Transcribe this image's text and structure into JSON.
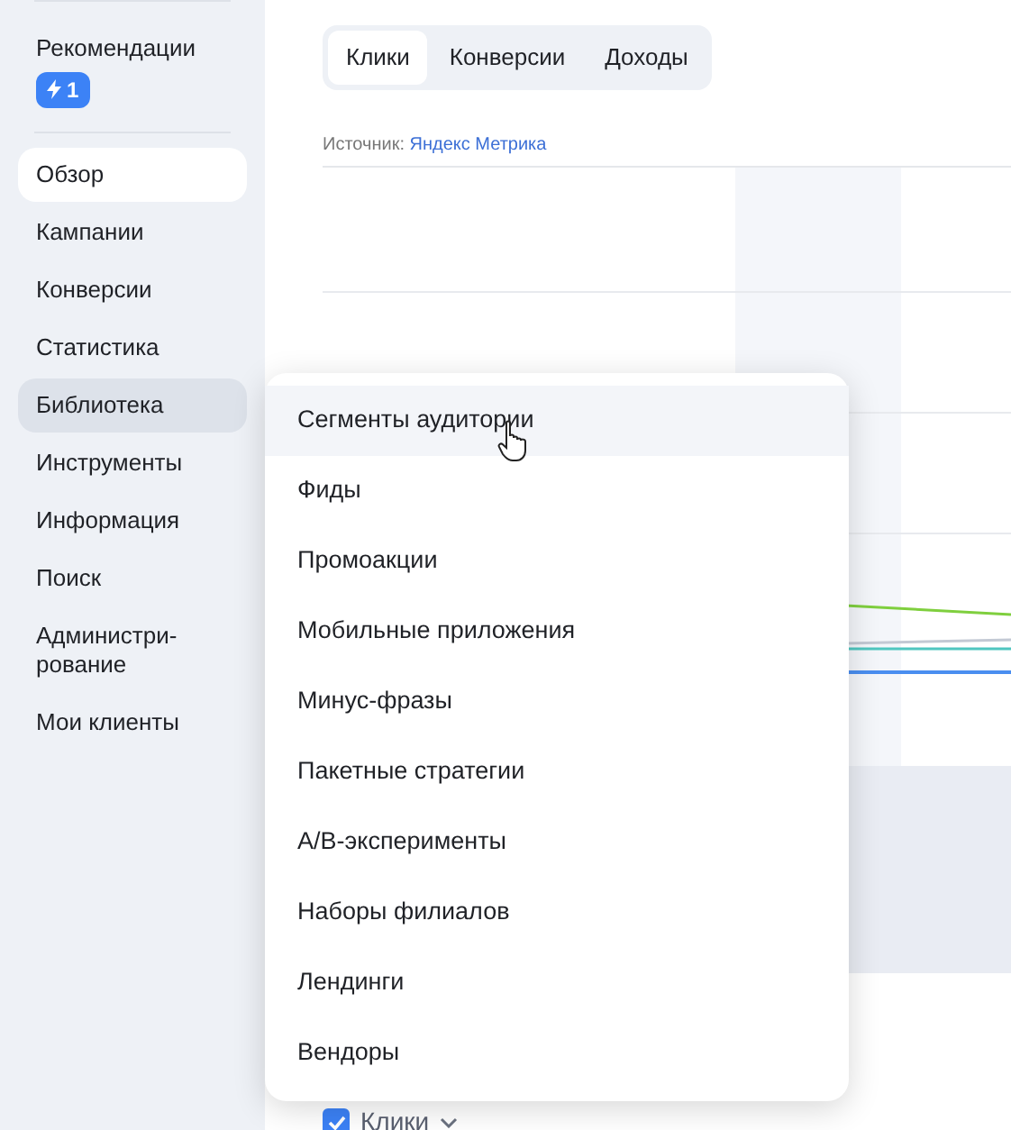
{
  "sidebar": {
    "recommendations": {
      "label": "Рекомендации",
      "badge": "1"
    },
    "items": [
      {
        "label": "Обзор",
        "selected": true,
        "expanded": false
      },
      {
        "label": "Кампании",
        "selected": false,
        "expanded": false
      },
      {
        "label": "Конверсии",
        "selected": false,
        "expanded": false
      },
      {
        "label": "Статистика",
        "selected": false,
        "expanded": false
      },
      {
        "label": "Библиотека",
        "selected": false,
        "expanded": true
      },
      {
        "label": "Инструменты",
        "selected": false,
        "expanded": false
      },
      {
        "label": "Информация",
        "selected": false,
        "expanded": false
      },
      {
        "label": "Поиск",
        "selected": false,
        "expanded": false
      },
      {
        "label": "Администри-рование",
        "selected": false,
        "expanded": false
      },
      {
        "label": "Мои клиенты",
        "selected": false,
        "expanded": false
      }
    ]
  },
  "tabs": [
    {
      "label": "Клики",
      "selected": true
    },
    {
      "label": "Конверсии",
      "selected": false
    },
    {
      "label": "Доходы",
      "selected": false
    }
  ],
  "source": {
    "label": "Источник:",
    "link": "Яндекс Метрика"
  },
  "legend": {
    "label": "Клики",
    "checked": true
  },
  "menu": {
    "items": [
      {
        "label": "Сегменты аудитории",
        "selected": true
      },
      {
        "label": "Фиды",
        "selected": false
      },
      {
        "label": "Промоакции",
        "selected": false
      },
      {
        "label": "Мобильные приложения",
        "selected": false
      },
      {
        "label": "Минус-фразы",
        "selected": false
      },
      {
        "label": "Пакетные стратегии",
        "selected": false
      },
      {
        "label": "A/B-эксперименты",
        "selected": false
      },
      {
        "label": "Наборы филиалов",
        "selected": false
      },
      {
        "label": "Лендинги",
        "selected": false
      },
      {
        "label": "Вендоры",
        "selected": false
      }
    ]
  }
}
